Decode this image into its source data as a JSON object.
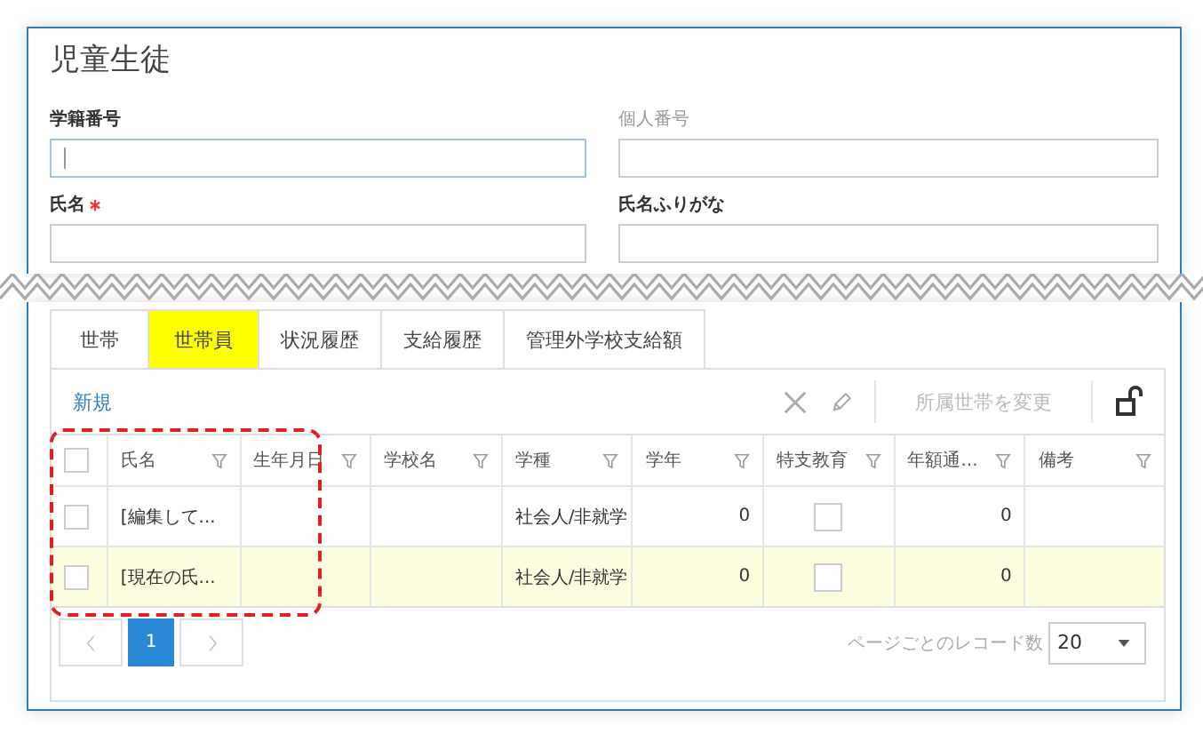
{
  "title": "児童生徒",
  "fields": [
    {
      "label": "学籍番号",
      "required": false,
      "disabled": false,
      "focused": true
    },
    {
      "label": "個人番号",
      "required": false,
      "disabled": true,
      "focused": false
    },
    {
      "label": "氏名",
      "required": true,
      "disabled": false,
      "focused": false
    },
    {
      "label": "氏名ふりがな",
      "required": false,
      "disabled": false,
      "focused": false
    }
  ],
  "tabs": [
    {
      "label": "世帯",
      "selected": false,
      "highlighted": false
    },
    {
      "label": "世帯員",
      "selected": true,
      "highlighted": true
    },
    {
      "label": "状況履歴",
      "selected": false,
      "highlighted": false
    },
    {
      "label": "支給履歴",
      "selected": false,
      "highlighted": false
    },
    {
      "label": "管理外学校支給額",
      "selected": false,
      "highlighted": false
    }
  ],
  "toolbar": {
    "new": "新規",
    "change_household": "所属世帯を変更",
    "change_household_disabled": true
  },
  "table": {
    "all_checked": false,
    "columns": [
      "氏名",
      "生年月日",
      "学校名",
      "学種",
      "学年",
      "特支教育",
      "年額通...",
      "備考"
    ],
    "rows": [
      {
        "checked": false,
        "highlighted": false,
        "name": "[編集して...",
        "birth": "",
        "school": "",
        "type": "社会人/非就学",
        "grade": "0",
        "special": false,
        "annual": "0",
        "note": ""
      },
      {
        "checked": false,
        "highlighted": true,
        "name": "[現在の氏...",
        "birth": "",
        "school": "",
        "type": "社会人/非就学",
        "grade": "0",
        "special": false,
        "annual": "0",
        "note": ""
      }
    ]
  },
  "pager": {
    "pages": [
      {
        "label": "1",
        "selected": true
      }
    ],
    "per_page_label": "ページごとのレコード数",
    "per_page": "20"
  }
}
